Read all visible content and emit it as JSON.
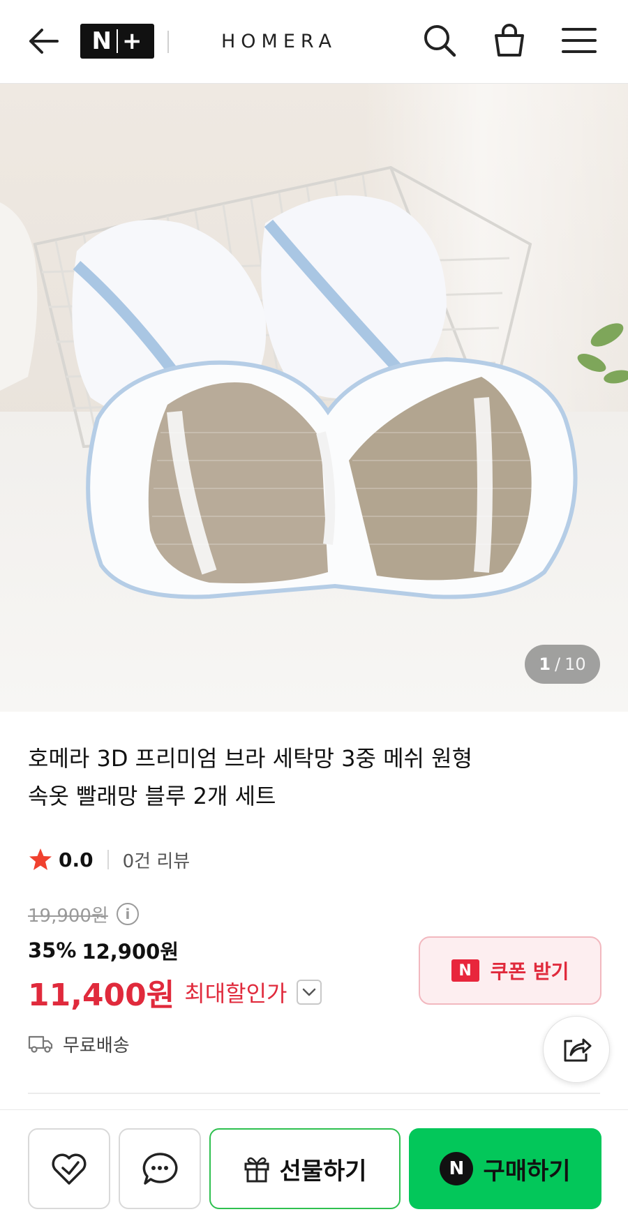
{
  "header": {
    "badge_left": "N",
    "badge_right": "+",
    "brand": "HOMERA"
  },
  "gallery": {
    "current": "1",
    "separator": "/",
    "total": "10"
  },
  "product": {
    "title_line1": "호메라 3D 프리미엄 브라 세탁망 3중 메쉬 원형",
    "title_line2": "속옷 빨래망 블루 2개 세트",
    "rating": "0.0",
    "review_count": "0건 리뷰",
    "original_price": "19,900원",
    "discount_percent": "35%",
    "sale_price": "12,900원",
    "max_discount_price": "11,400원",
    "max_discount_label": "최대할인가",
    "shipping": "무료배송"
  },
  "coupon": {
    "badge": "N",
    "label": "쿠폰 받기"
  },
  "bottom_bar": {
    "gift_label": "선물하기",
    "buy_badge": "N",
    "buy_label": "구매하기"
  },
  "colors": {
    "accent_red": "#e02a3c",
    "naver_green": "#03c75a",
    "coupon_bg": "#fdeef0"
  },
  "icons": [
    "back-arrow-icon",
    "search-icon",
    "shopping-bag-icon",
    "hamburger-menu-icon",
    "star-icon",
    "info-icon",
    "chevron-down-icon",
    "truck-icon",
    "share-icon",
    "heart-check-icon",
    "chat-bubble-icon",
    "gift-icon"
  ]
}
